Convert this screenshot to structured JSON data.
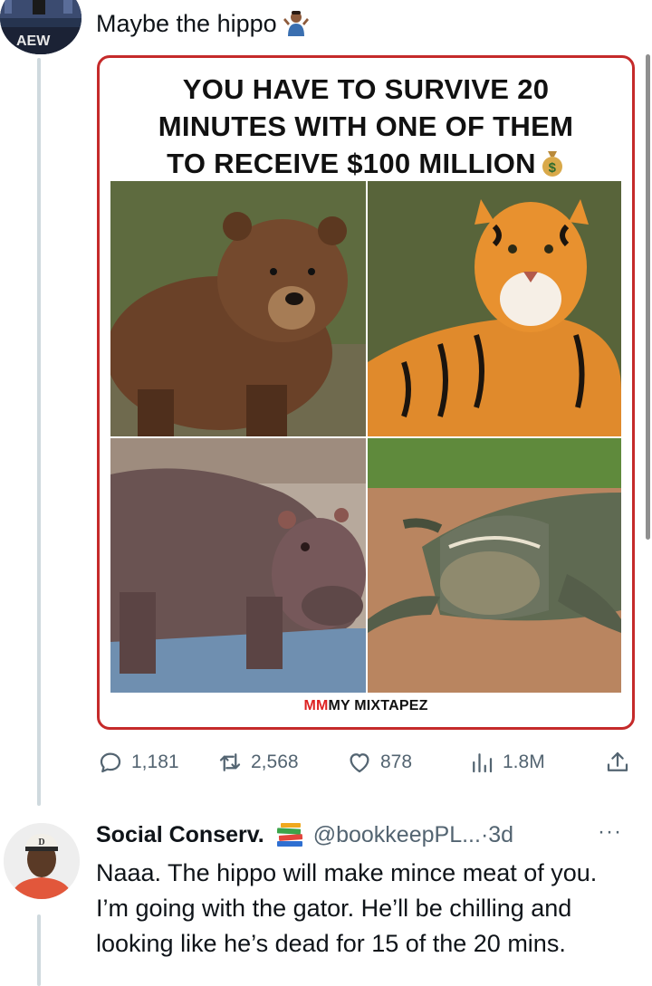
{
  "tweet1": {
    "text": "Maybe the hippo",
    "emoji": "person-shrugging-emoji",
    "meme_title_lines": [
      "YOU HAVE TO SURVIVE 20",
      "MINUTES WITH ONE OF THEM",
      "TO RECEIVE $100 MILLION"
    ],
    "meme_emoji": "money-bag-emoji",
    "animals": [
      "bear",
      "tiger",
      "hippo",
      "alligator"
    ],
    "watermark_logo": "MM",
    "watermark_text": "MY MIXTAPEZ",
    "stats": {
      "replies": "1,181",
      "retweets": "2,568",
      "likes": "878",
      "views": "1.8M"
    },
    "avatar_text": "AEW"
  },
  "tweet2": {
    "author_name": "Social Conserv.",
    "author_emoji": "books-emoji",
    "handle": "@bookkeepPL...",
    "dot": "·",
    "time": "3d",
    "more": "···",
    "text": "Naaa. The hippo will make mince meat of you. I’m going with the gator. He’ll be chilling and looking like he’s dead for 15 of the 20 mins."
  },
  "colors": {
    "thread_line": "#cfd9de",
    "secondary_text": "#536471",
    "card_border": "#c52a2a"
  }
}
